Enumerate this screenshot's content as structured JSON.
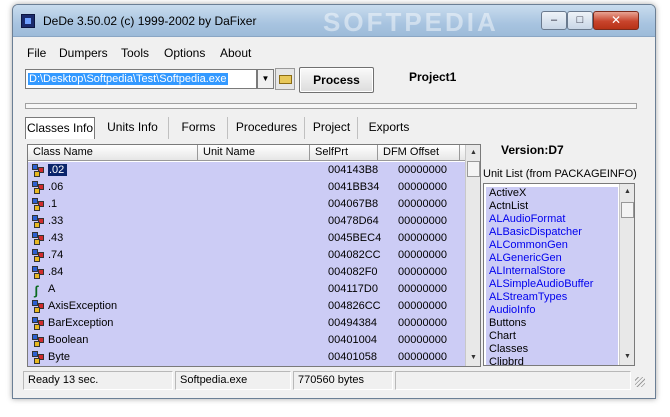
{
  "window": {
    "title": "DeDe 3.50.02 (c) 1999-2002 by DaFixer",
    "watermark": "SOFTPEDIA",
    "controls": {
      "minimize": "–",
      "maximize": "□",
      "close": "✕"
    }
  },
  "menu": [
    "File",
    "Dumpers",
    "Tools",
    "Options",
    "About"
  ],
  "toolbar": {
    "path_value": "D:\\Desktop\\Softpedia\\Test\\Softpedia.exe",
    "process_label": "Process",
    "project_label": "Project1"
  },
  "tabs": [
    "Classes Info",
    "Units Info",
    "Forms",
    "Procedures",
    "Project",
    "Exports"
  ],
  "active_tab": "Classes Info",
  "grid": {
    "columns": [
      "Class Name",
      "Unit Name",
      "SelfPrt",
      "DFM Offset"
    ],
    "rows": [
      {
        "icon": "cube-icon",
        "name": ".02",
        "unit": "",
        "self": "004143B8",
        "dfm": "00000000"
      },
      {
        "icon": "cube-icon",
        "name": ".06",
        "unit": "",
        "self": "0041BB34",
        "dfm": "00000000"
      },
      {
        "icon": "cube-icon",
        "name": ".1",
        "unit": "",
        "self": "004067B8",
        "dfm": "00000000"
      },
      {
        "icon": "cube-icon",
        "name": ".33",
        "unit": "",
        "self": "00478D64",
        "dfm": "00000000"
      },
      {
        "icon": "cube-icon",
        "name": ".43",
        "unit": "",
        "self": "0045BEC4",
        "dfm": "00000000"
      },
      {
        "icon": "cube-icon",
        "name": ".74",
        "unit": "",
        "self": "004082CC",
        "dfm": "00000000"
      },
      {
        "icon": "cube-icon",
        "name": ".84",
        "unit": "",
        "self": "004082F0",
        "dfm": "00000000"
      },
      {
        "icon": "hook-icon",
        "name": "A",
        "unit": "",
        "self": "004117D0",
        "dfm": "00000000"
      },
      {
        "icon": "cube-icon",
        "name": "AxisException",
        "unit": "",
        "self": "004826CC",
        "dfm": "00000000"
      },
      {
        "icon": "cube-icon",
        "name": "BarException",
        "unit": "",
        "self": "00494384",
        "dfm": "00000000"
      },
      {
        "icon": "cube-icon",
        "name": "Boolean",
        "unit": "",
        "self": "00401004",
        "dfm": "00000000"
      },
      {
        "icon": "cube-icon",
        "name": "Byte",
        "unit": "",
        "self": "00401058",
        "dfm": "00000000"
      }
    ]
  },
  "version_label": "Version:D7",
  "unit_list": {
    "label": "Unit List (from PACKAGEINFO)",
    "items": [
      {
        "name": "ActiveX",
        "blue": false
      },
      {
        "name": "ActnList",
        "blue": false
      },
      {
        "name": "ALAudioFormat",
        "blue": true
      },
      {
        "name": "ALBasicDispatcher",
        "blue": true
      },
      {
        "name": "ALCommonGen",
        "blue": true
      },
      {
        "name": "ALGenericGen",
        "blue": true
      },
      {
        "name": "ALInternalStore",
        "blue": true
      },
      {
        "name": "ALSimpleAudioBuffer",
        "blue": true
      },
      {
        "name": "ALStreamTypes",
        "blue": true
      },
      {
        "name": "AudioInfo",
        "blue": true
      },
      {
        "name": "Buttons",
        "blue": false
      },
      {
        "name": "Chart",
        "blue": false
      },
      {
        "name": "Classes",
        "blue": false
      },
      {
        "name": "Clipbrd",
        "blue": false
      }
    ]
  },
  "status": {
    "state": "Ready 13 sec.",
    "file": "Softpedia.exe",
    "size": "770560 bytes"
  }
}
